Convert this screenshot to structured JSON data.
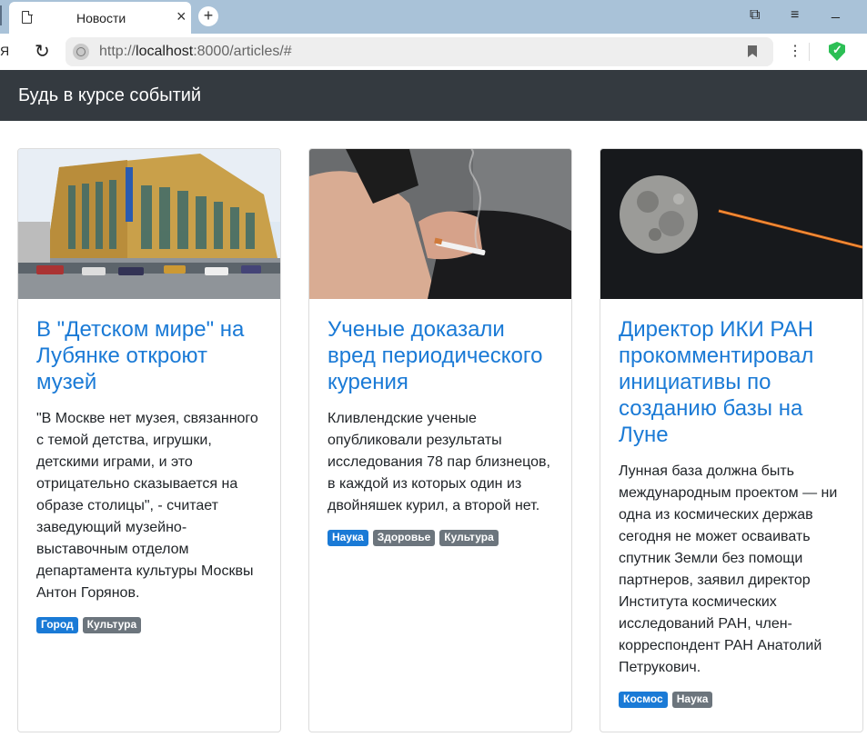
{
  "browser": {
    "tab_title": "Новости",
    "tab_close": "×",
    "new_tab": "+",
    "url_prefix": "http://",
    "url_host": "localhost",
    "url_rest": ":8000/articles/#",
    "partial_icon": "Я",
    "reload": "↻",
    "menu": "⋮",
    "window_icons": {
      "collections": "⧉",
      "hamburger": "≡",
      "minimize": "_"
    }
  },
  "navbar": {
    "brand": "Будь в курсе событий"
  },
  "articles": [
    {
      "title": "В \"Детском мире\" на Лубянке откроют музей",
      "text": "\"В Москве нет музея, связанного с темой детства, игрушки, детскими играми, и это отрицательно сказывается на образе столицы\", - считает заведующий музейно-выставочным отделом департамента культуры Москвы Антон Горянов.",
      "tags": [
        {
          "label": "Город",
          "variant": "primary"
        },
        {
          "label": "Культура",
          "variant": "secondary"
        }
      ],
      "image": "department-store-building-photo"
    },
    {
      "title": "Ученые доказали вред периодического курения",
      "text": "Кливлендские ученые опубликовали результаты исследования 78 пар близнецов, в каждой из которых один из двойняшек курил, а второй нет.",
      "tags": [
        {
          "label": "Наука",
          "variant": "primary"
        },
        {
          "label": "Здоровье",
          "variant": "secondary"
        },
        {
          "label": "Культура",
          "variant": "secondary"
        }
      ],
      "image": "hand-with-cigarette-photo"
    },
    {
      "title": "Директор ИКИ РАН прокомментировал инициативы по созданию базы на Луне",
      "text": "Лунная база должна быть международным проектом — ни одна из космических держав сегодня не может осваивать спутник Земли без помощи партнеров, заявил директор Института космических исследований РАН, член-корреспондент РАН Анатолий Петрукович.",
      "tags": [
        {
          "label": "Космос",
          "variant": "primary"
        },
        {
          "label": "Наука",
          "variant": "secondary"
        }
      ],
      "image": "moon-and-rocket-trail-photo"
    }
  ],
  "colors": {
    "navbar": "#343a40",
    "link": "#1a7ad6",
    "badge_primary": "#1a7ad6",
    "badge_secondary": "#6c757d",
    "tabbar": "#a9c2d8"
  }
}
